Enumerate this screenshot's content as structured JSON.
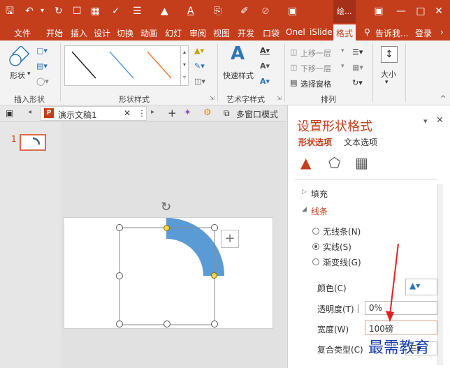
{
  "quick_access": {
    "save_icon": "save-icon",
    "undo_icon": "undo-icon",
    "redo_icon": "redo-icon"
  },
  "context_title": "绘...",
  "tabs": [
    "文件",
    "开始",
    "插入",
    "设计",
    "切换",
    "动画",
    "幻灯",
    "审阅",
    "视图",
    "开发",
    "口袋",
    "Onel",
    "iSlide",
    "格式"
  ],
  "tell_me": "告诉我...",
  "login": "登录",
  "ribbon": {
    "insert_shapes": {
      "label": "插入形状",
      "shapes_btn": "形状"
    },
    "shape_styles": {
      "label": "形状样式"
    },
    "wordart": {
      "label": "艺术字样式",
      "quick_styles": "快速样式"
    },
    "arrange": {
      "label": "排列",
      "bring_forward": "上移一层",
      "send_backward": "下移一层",
      "selection_pane": "选择窗格"
    },
    "size": {
      "label": "大小"
    }
  },
  "doc_tab": {
    "title": "演示文稿1",
    "multi_window": "多窗口模式"
  },
  "thumbnail": {
    "number": "1"
  },
  "format_pane": {
    "title": "设置形状格式",
    "tab_shape": "形状选项",
    "tab_text": "文本选项",
    "fill": "填充",
    "line": "线条",
    "no_line": "无线条(N)",
    "solid_line": "实线(S)",
    "gradient_line": "渐变线(G)",
    "color": "颜色(C)",
    "transparency": "透明度(T)",
    "transparency_value": "0%",
    "width": "宽度(W)",
    "width_value": "100磅",
    "compound": "复合类型(C)"
  },
  "watermark": "最需教育",
  "colors": {
    "accent": "#c43e1c",
    "arc": "#5b9bd5"
  }
}
